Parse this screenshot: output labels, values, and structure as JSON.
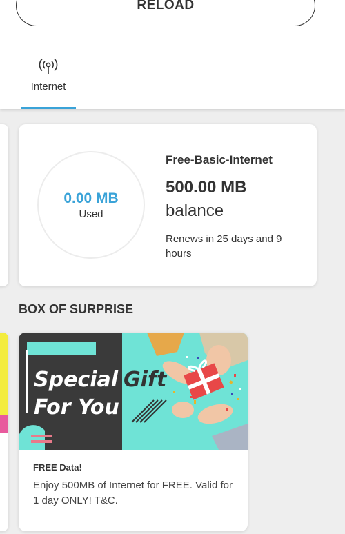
{
  "header": {
    "reload_label": "RELOAD",
    "tabs": [
      {
        "label": "Internet",
        "icon": "antenna-signal-icon",
        "active": true
      }
    ]
  },
  "plan": {
    "used_value": "0.00 MB",
    "used_label": "Used",
    "name": "Free-Basic-Internet",
    "balance_amount": "500.00 MB",
    "balance_label": "balance",
    "renews_text": "Renews in 25 days and 9 hours"
  },
  "section": {
    "title": "BOX OF SURPRISE"
  },
  "promo": {
    "image_line1_word1": "Special",
    "image_line1_word2": "Gift",
    "image_line2": "For You",
    "title": "FREE Data!",
    "description": "Enjoy 500MB of Internet for FREE. Valid for 1 day ONLY! T&C."
  },
  "colors": {
    "accent": "#3aa3d8",
    "banner_dark": "#3a3a3a",
    "banner_teal": "#6fe3d6",
    "gift_red": "#e84848",
    "text": "#333333"
  }
}
